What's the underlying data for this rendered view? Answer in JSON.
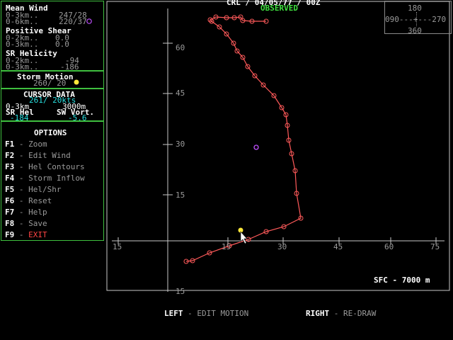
{
  "header": {
    "station": "CRL / 04/05/77 / 00Z",
    "status": "OBSERVED"
  },
  "colors": {
    "panel_border": "#3fbf3f",
    "hodograph": "#ff5a5a",
    "cyan_values": "#29e0e0",
    "observed": "#3fe03f",
    "exit": "#ff4444",
    "storm_motion_marker": "#ffe83a",
    "cursor_marker": "#ffe83a",
    "helicity_marker": "#c050ff"
  },
  "compass": {
    "top": "180",
    "left_right": "090---+---270",
    "bottom": "360"
  },
  "mean_wind": {
    "title": "Mean Wind",
    "rows": [
      {
        "label": "0-3km..",
        "value": "247/28"
      },
      {
        "label": "0-6km..",
        "value": "220/37"
      }
    ]
  },
  "positive_shear": {
    "title": "Positive Shear",
    "rows": [
      {
        "label": "0-2km..",
        "value": "0.0"
      },
      {
        "label": "0-3km..",
        "value": "0.0"
      }
    ]
  },
  "sr_helicity": {
    "title": "SR Helicity",
    "rows": [
      {
        "label": "0-2km..",
        "value": "-94"
      },
      {
        "label": "0-3km..",
        "value": "-186"
      }
    ]
  },
  "storm_motion": {
    "title": "Storm Motion",
    "value": "260/ 20"
  },
  "cursor_data": {
    "title": "CURSOR DATA",
    "wind": "261/ 20kts",
    "depth_label": "0-3km",
    "depth_value": "3000m",
    "col1_label": "SR Hel",
    "col2_label": "SW Vort.",
    "col1_value": "-184",
    "col2_value": "-5.6"
  },
  "options": {
    "title": "OPTIONS",
    "items": [
      {
        "key": "F1",
        "label": "Zoom"
      },
      {
        "key": "F2",
        "label": "Edit Wind"
      },
      {
        "key": "F3",
        "label": "Hel Contours"
      },
      {
        "key": "F4",
        "label": "Storm Inflow"
      },
      {
        "key": "F5",
        "label": "Hel/Shr"
      },
      {
        "key": "F6",
        "label": "Reset"
      },
      {
        "key": "F7",
        "label": "Help"
      },
      {
        "key": "F8",
        "label": "Save"
      },
      {
        "key": "F9",
        "label": "EXIT"
      }
    ]
  },
  "plot": {
    "x_ticks": [
      "15",
      "15",
      "30",
      "45",
      "60",
      "75"
    ],
    "y_ticks": [
      "60",
      "45",
      "30",
      "15",
      "15"
    ],
    "sfc_label": "SFC - 7000 m"
  },
  "footer": {
    "left_key": "LEFT",
    "left_action": "EDIT MOTION",
    "right_key": "RIGHT",
    "right_action": "RE-DRAW"
  }
}
